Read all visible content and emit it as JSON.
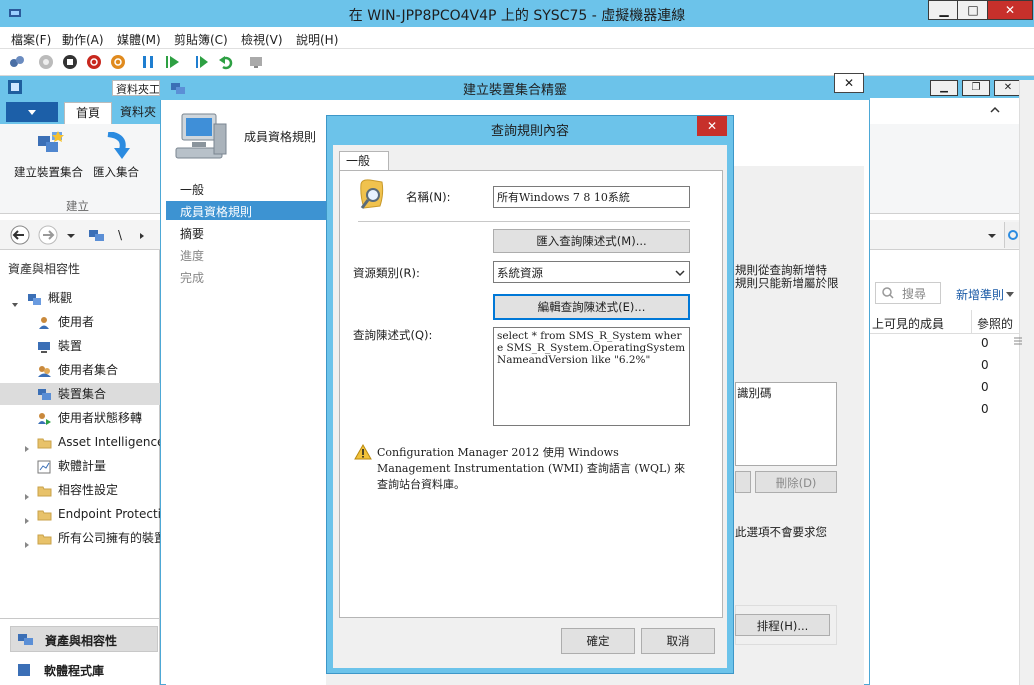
{
  "vm": {
    "title": "在 WIN-JPP8PCO4V4P 上的 SYSC75 - 虛擬機器連線",
    "controls": {
      "minimize": "▁",
      "maximize": "□",
      "close": "✕"
    },
    "menu": [
      "檔案(F)",
      "動作(A)",
      "媒體(M)",
      "剪貼簿(C)",
      "檢視(V)",
      "說明(H)"
    ]
  },
  "console": {
    "title_partial": "資料夾工",
    "ribbon_tabs": [
      "首頁",
      "資料夾"
    ],
    "ribbon_buttons": [
      "建立裝置集合",
      "匯入集合"
    ],
    "ribbon_group": "建立",
    "section_title": "資產與相容性",
    "tree": [
      {
        "label": "概觀",
        "icon": "overview-icon"
      },
      {
        "label": "使用者",
        "icon": "user-icon"
      },
      {
        "label": "裝置",
        "icon": "device-icon"
      },
      {
        "label": "使用者集合",
        "icon": "user-collection-icon"
      },
      {
        "label": "裝置集合",
        "icon": "device-collection-icon"
      },
      {
        "label": "使用者狀態移轉",
        "icon": "user-state-icon"
      },
      {
        "label": "Asset Intelligence",
        "icon": "folder-icon"
      },
      {
        "label": "軟體計量",
        "icon": "metering-icon"
      },
      {
        "label": "相容性設定",
        "icon": "folder-icon"
      },
      {
        "label": "Endpoint Protection",
        "icon": "folder-icon"
      },
      {
        "label": "所有公司擁有的裝置",
        "icon": "folder-icon"
      }
    ],
    "workspaces": [
      "資產與相容性",
      "軟體程式庫"
    ],
    "right": {
      "search_placeholder": "搜尋",
      "add_criteria": "新增準則",
      "columns": [
        "上可見的成員",
        "參照的"
      ],
      "values": [
        "0",
        "0",
        "0",
        "0"
      ]
    }
  },
  "wizard": {
    "title": "建立裝置集合精靈",
    "header": "成員資格規則",
    "nav": [
      "一般",
      "成員資格規則",
      "摘要",
      "進度",
      "完成"
    ],
    "partial_text_1": "規則從查詢新增特",
    "partial_text_2": "規則只能新增屬於限",
    "column_partial": "識別碼",
    "delete_button": "刪除(D)",
    "option_text": "此選項不會要求您",
    "schedule_button": "排程(H)..."
  },
  "dialog": {
    "title": "查詢規則內容",
    "tab": "一般",
    "name_label": "名稱(N):",
    "name_value": "所有Windows 7 8 10系統",
    "import_button": "匯入查詢陳述式(M)...",
    "resource_label": "資源類別(R):",
    "resource_value": "系統資源",
    "edit_button": "編輯查詢陳述式(E)...",
    "query_label": "查詢陳述式(Q):",
    "query_value": "select * from SMS_R_System where SMS_R_System.OperatingSystemNameandVersion like \"6.2%\"",
    "warning": "Configuration Manager 2012 使用 Windows Management Instrumentation (WMI) 查詢語言 (WQL) 來查詢站台資料庫。",
    "ok": "確定",
    "cancel": "取消"
  }
}
